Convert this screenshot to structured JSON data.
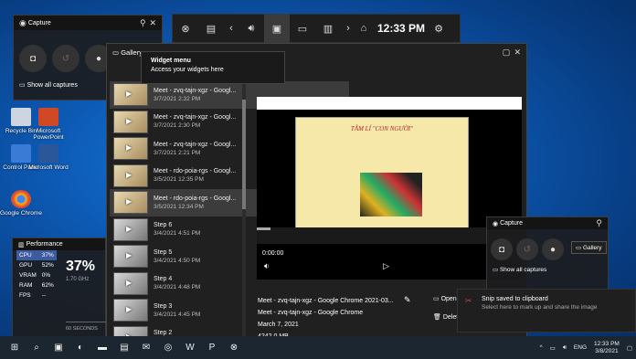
{
  "desktop_icons": [
    {
      "label": "Recycle Bin",
      "color": "#cdd6e0"
    },
    {
      "label": "Microsoft PowerPoint",
      "color": "#d24726"
    },
    {
      "label": "Control Panel",
      "color": "#3a7bd5"
    },
    {
      "label": "Microsoft Word",
      "color": "#2b579a"
    },
    {
      "label": "Google Chrome",
      "color": "#e8e8e8"
    }
  ],
  "capture": {
    "title": "Capture",
    "show_all": "Show all captures"
  },
  "gamebar": {
    "time": "12:33 PM"
  },
  "gallery": {
    "title": "Gallery",
    "items": [
      {
        "title": "Meet - zvq-tajn-xgz - Googl...",
        "date": "3/7/2021 2:32 PM",
        "dark": false
      },
      {
        "title": "Meet - zvq-tajn-xgz - Googl...",
        "date": "3/7/2021 2:30 PM",
        "dark": false
      },
      {
        "title": "Meet - zvq-tajn-xgz - Googl...",
        "date": "3/7/2021 2:21 PM",
        "dark": false
      },
      {
        "title": "Meet - rdo-poia-rgs - Googl...",
        "date": "3/5/2021 12:35 PM",
        "dark": false
      },
      {
        "title": "Meet - rdo-poia-rgs - Googl...",
        "date": "3/5/2021 12:34 PM",
        "dark": false
      },
      {
        "title": "Step 6",
        "date": "3/4/2021 4:51 PM",
        "dark": true
      },
      {
        "title": "Step 5",
        "date": "3/4/2021 4:50 PM",
        "dark": true
      },
      {
        "title": "Step 4",
        "date": "3/4/2021 4:48 PM",
        "dark": true
      },
      {
        "title": "Step 3",
        "date": "3/4/2021 4:45 PM",
        "dark": true
      },
      {
        "title": "Step 2",
        "date": "3/4/2021 4:44 PM",
        "dark": true
      }
    ],
    "player_time": "0:00:00",
    "meta": {
      "filename": "Meet - zvq-tajn-xgz - Google Chrome 2021-03...",
      "app": "Meet - zvq-tajn-xgz - Google Chrome",
      "date": "March 7, 2021",
      "size": "4242.0 MB"
    },
    "open_label": "Open",
    "delete_label": "Delet"
  },
  "widget_menu": {
    "title": "Widget menu",
    "subtitle": "Access your widgets here"
  },
  "slide": {
    "title": "TÂM LÍ \"CON NGƯỜI\""
  },
  "performance": {
    "title": "Performance",
    "rows": [
      {
        "label": "CPU",
        "value": "37%"
      },
      {
        "label": "GPU",
        "value": "52%"
      },
      {
        "label": "VRAM",
        "value": "0%"
      },
      {
        "label": "RAM",
        "value": "62%"
      },
      {
        "label": "FPS",
        "value": "--"
      }
    ],
    "big_value": "37%",
    "ghz": "1.70 GHz",
    "seconds": "60 SECONDS"
  },
  "capture2": {
    "title": "Capture",
    "show_all": "Show all captures",
    "gallery": "Gallery"
  },
  "toast": {
    "title": "Snip saved to clipboard",
    "body": "Select here to mark up and share the image"
  },
  "taskbar": {
    "lang": "ENG",
    "time": "12:33 PM",
    "date": "3/8/2021"
  }
}
